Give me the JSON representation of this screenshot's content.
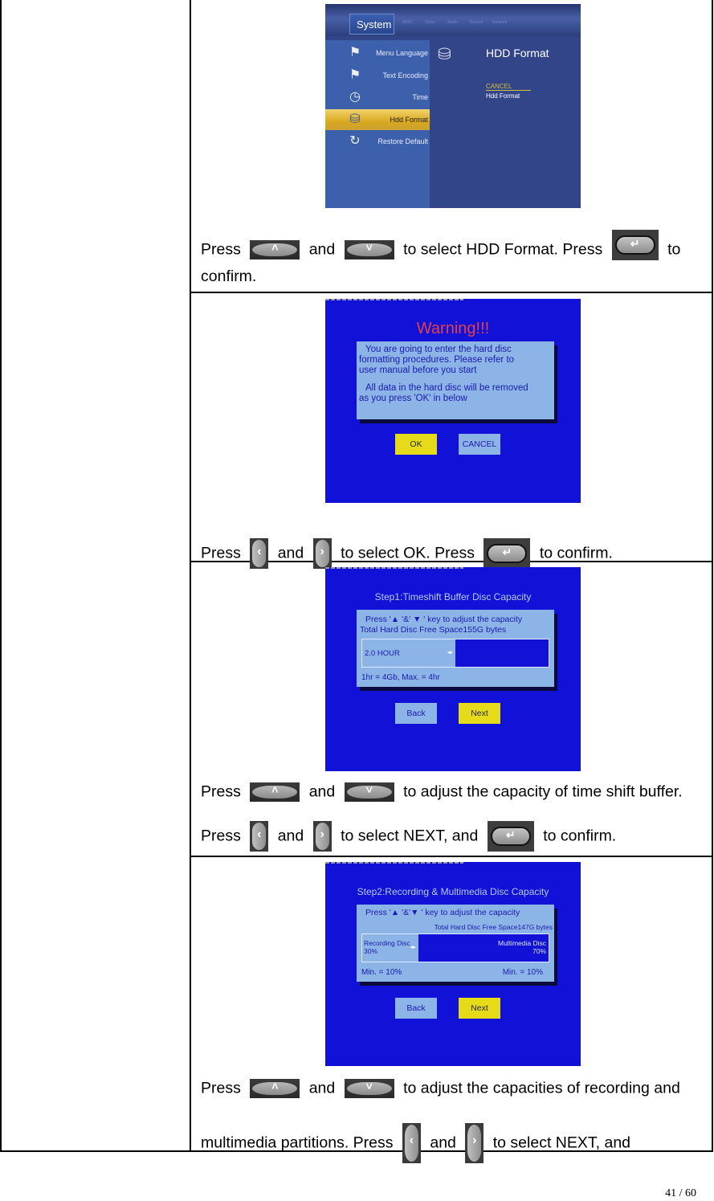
{
  "page": {
    "number": "41 / 60"
  },
  "steps": [
    {
      "screen": {
        "type": "system-menu",
        "top_tabs": [
          "System",
          "MISC",
          "Video",
          "Audio",
          "Record",
          "Network"
        ],
        "menu_items": [
          "Menu Language",
          "Text Encoding",
          "Time",
          "Hdd Format",
          "Restore Default"
        ],
        "selected_item": "Hdd Format",
        "panel_title": "HDD Format",
        "panel_options": [
          "CANCEL",
          "Hdd Format"
        ]
      },
      "instruction": {
        "press": "Press",
        "and": "and",
        "text1": "to select HDD Format. Press",
        "text2": "to",
        "text3": "confirm."
      }
    },
    {
      "screen": {
        "title": "Warning!!!",
        "message_1": [
          "You are going to enter the hard disc",
          "formatting procedures. Please refer to",
          "user manual before you start"
        ],
        "message_2": [
          "All data in the hard disc will be removed",
          "as you press 'OK' in below"
        ],
        "buttons": [
          "OK",
          "CANCEL"
        ],
        "selected_button": "OK"
      },
      "instruction": {
        "press": "Press",
        "and": "and",
        "text1": "to select OK. Press",
        "text2": "to confirm."
      }
    },
    {
      "screen": {
        "title": "Step1:Timeshift Buffer Disc Capacity",
        "hint": "Press '▲  '&' ▼ ' key to adjust the capacity",
        "free_space": "Total Hard Disc Free Space155G  bytes",
        "value_label": "2.0 HOUR",
        "value_fraction": 0.5,
        "note": "1hr = 4Gb, Max. = 4hr",
        "buttons": [
          "Back",
          "Next"
        ],
        "selected_button": "Next"
      },
      "instruction": {
        "press": "Press",
        "and": "and",
        "line1": "to adjust the capacity of time shift buffer.",
        "line2_a": "to select NEXT, and",
        "line2_b": "to confirm."
      }
    },
    {
      "screen": {
        "title": "Step2:Recording & Multimedia Disc Capacity",
        "hint": "Press '▲  '&'▼  ' key to adjust the capacity",
        "free_space": "Total Hard Disc Free Space147G   bytes",
        "left_label": "Recording Disc",
        "left_value": "30%",
        "right_label": "Multimedia Disc",
        "right_value": "70%",
        "recording_fraction": 0.3,
        "min_left": "Min. = 10%",
        "min_right": "Min. = 10%",
        "buttons": [
          "Back",
          "Next"
        ],
        "selected_button": "Next"
      },
      "instruction": {
        "press": "Press",
        "and": "and",
        "line1": "to adjust the capacities of recording and",
        "line2_a": "multimedia partitions. Press",
        "line2_b": "to select NEXT, and"
      }
    }
  ],
  "icons": {
    "up": "˄",
    "down": "˅",
    "left": "‹",
    "right": "›",
    "enter": "↵"
  }
}
